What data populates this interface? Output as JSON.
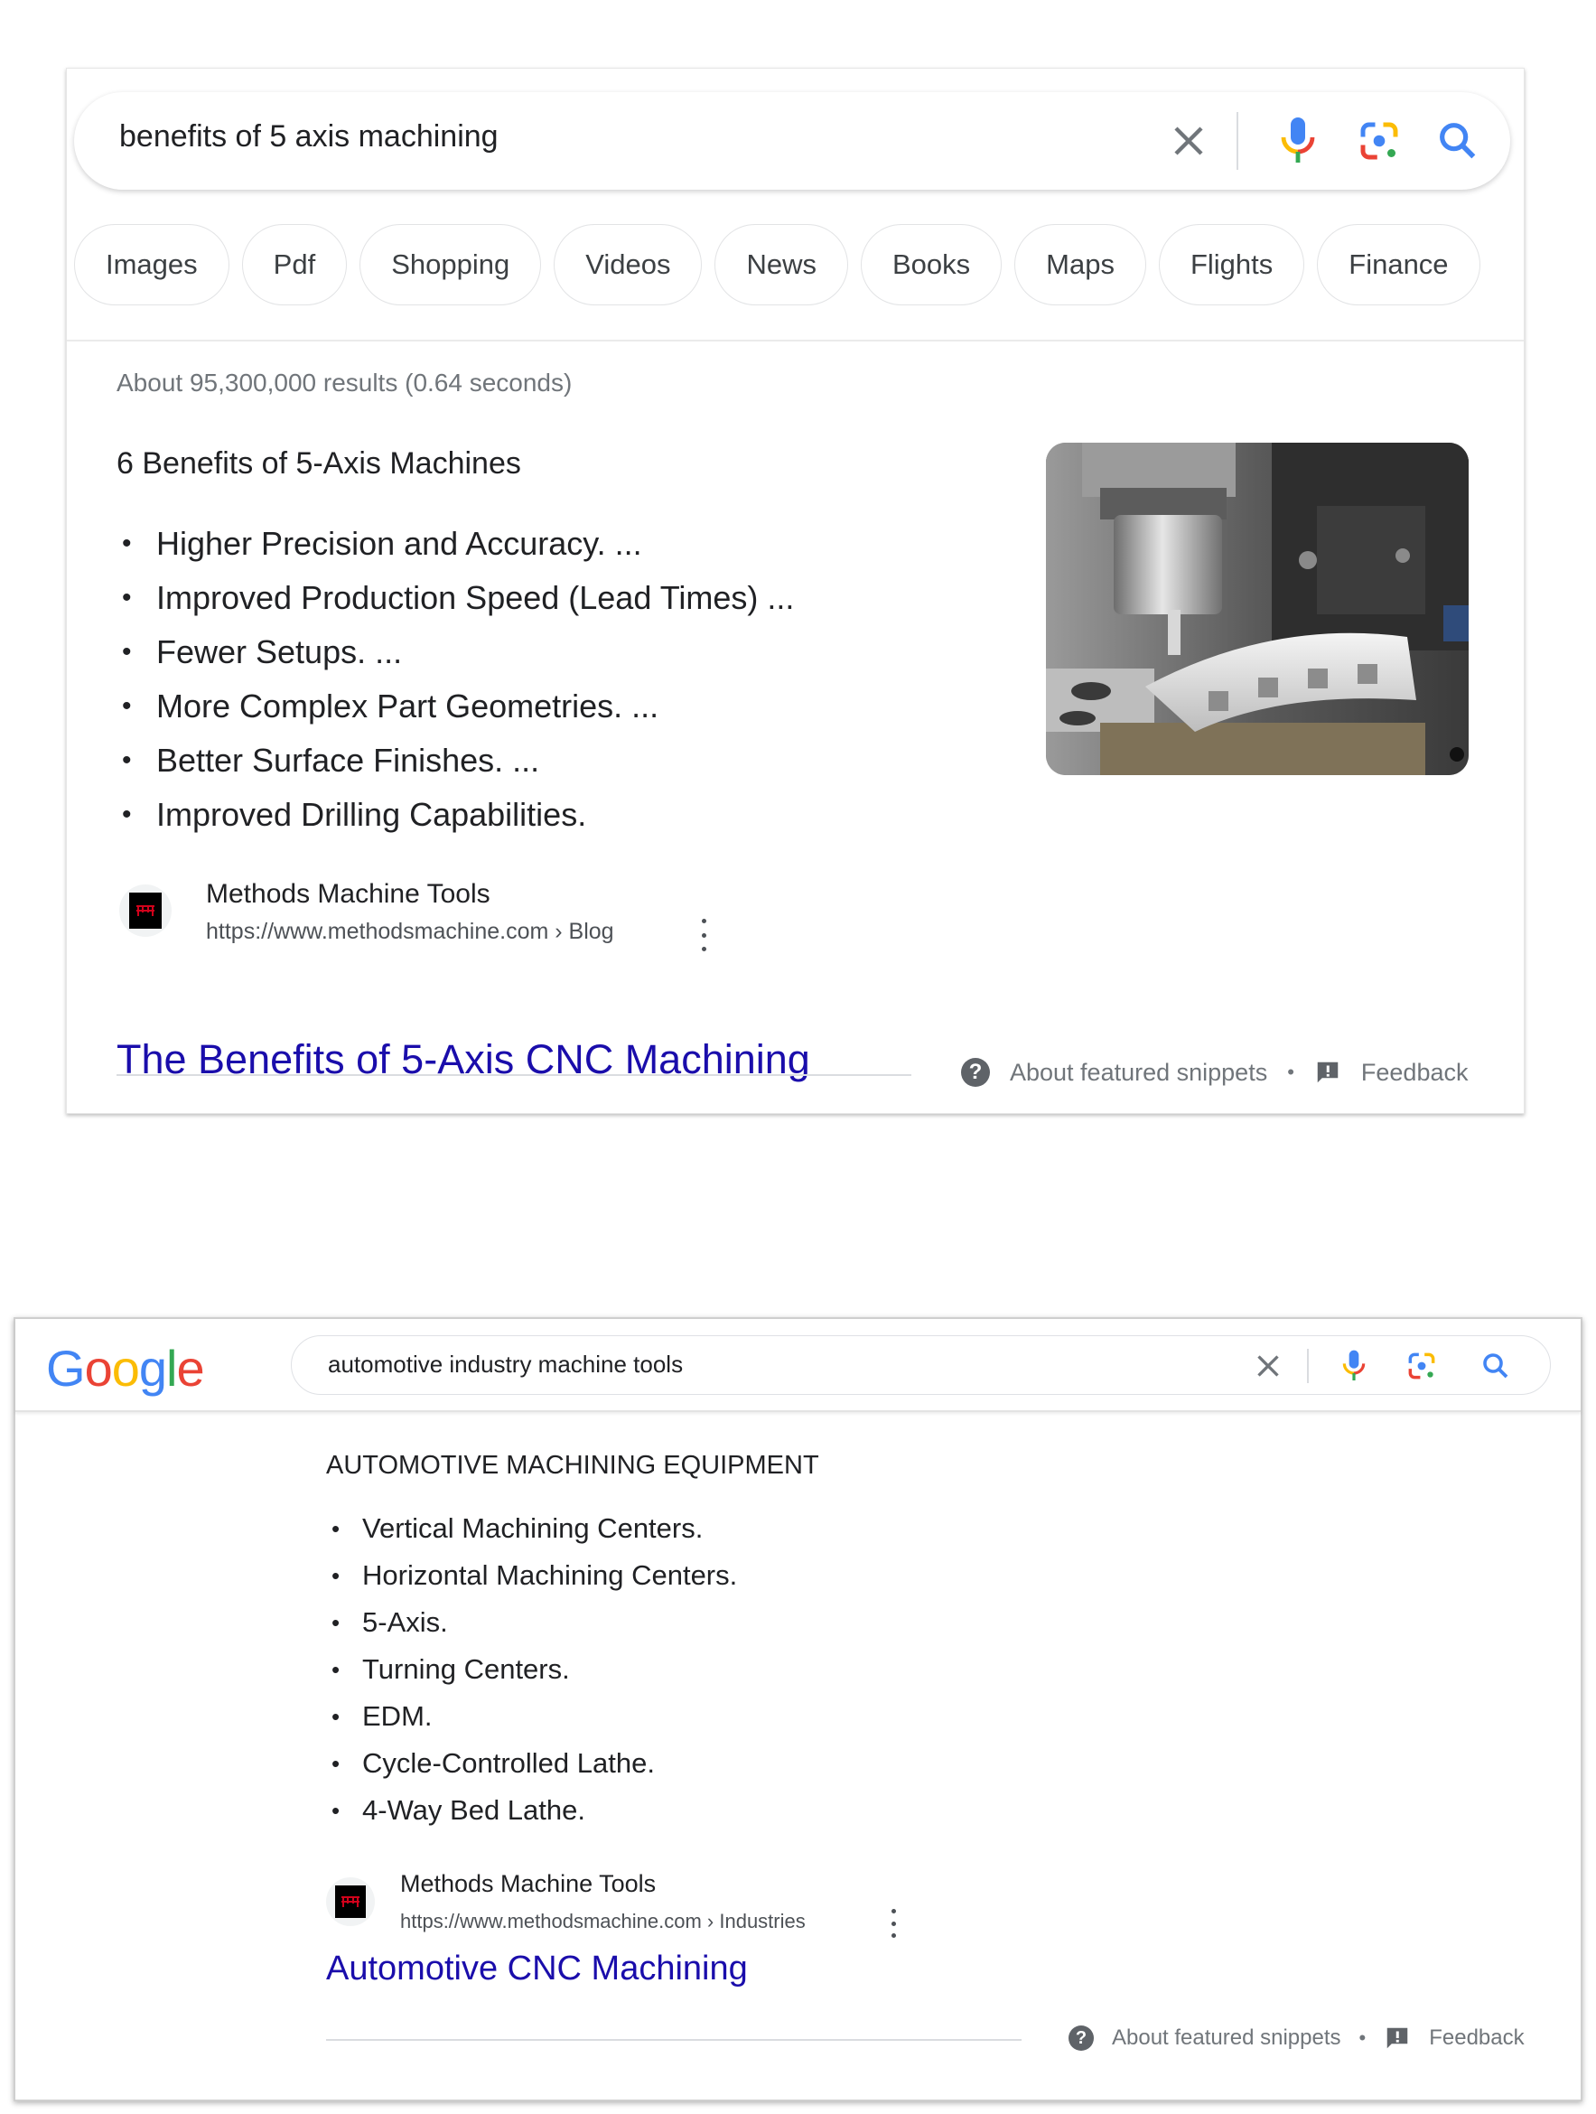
{
  "card1": {
    "search": {
      "query": "benefits of 5 axis machining",
      "icons": [
        "clear-icon",
        "voice-search-icon",
        "lens-icon",
        "search-icon"
      ]
    },
    "chips": [
      "Images",
      "Pdf",
      "Shopping",
      "Videos",
      "News",
      "Books",
      "Maps",
      "Flights",
      "Finance"
    ],
    "results_count": "About 95,300,000 results (0.64 seconds)",
    "snippet": {
      "heading": "6 Benefits of 5-Axis Machines",
      "bullets": [
        "Higher Precision and Accuracy. ...",
        "Improved Production Speed (Lead Times) ...",
        "Fewer Setups. ...",
        "More Complex Part Geometries. ...",
        "Better Surface Finishes. ...",
        "Improved Drilling Capabilities."
      ],
      "image_alt": "CNC machine spindle drilling an aluminum part"
    },
    "source": {
      "name": "Methods Machine Tools",
      "url": "https://www.methodsmachine.com",
      "breadcrumb": " › Blog"
    },
    "result_title": "The Benefits of 5-Axis CNC Machining",
    "footer": {
      "about": "About featured snippets",
      "separator": "•",
      "feedback": "Feedback"
    }
  },
  "card2": {
    "logo": [
      "G",
      "o",
      "o",
      "g",
      "l",
      "e"
    ],
    "logo_colors": [
      "#4285F4",
      "#EA4335",
      "#FBBC05",
      "#4285F4",
      "#34A853",
      "#EA4335"
    ],
    "search": {
      "query": "automotive industry machine tools"
    },
    "snippet": {
      "heading": "AUTOMOTIVE MACHINING EQUIPMENT",
      "bullets": [
        "Vertical Machining Centers.",
        "Horizontal Machining Centers.",
        "5-Axis.",
        "Turning Centers.",
        "EDM.",
        "Cycle-Controlled Lathe.",
        "4-Way Bed Lathe."
      ]
    },
    "source": {
      "name": "Methods Machine Tools",
      "url": "https://www.methodsmachine.com",
      "breadcrumb": " › Industries"
    },
    "result_title": "Automotive CNC Machining",
    "footer": {
      "about": "About featured snippets",
      "separator": "•",
      "feedback": "Feedback"
    }
  },
  "colors": {
    "link": "#1a0dab",
    "google_blue": "#4285F4",
    "google_red": "#EA4335",
    "google_yellow": "#FBBC05",
    "google_green": "#34A853",
    "secondary_text": "#70757a"
  },
  "bullet_glyph": "•"
}
